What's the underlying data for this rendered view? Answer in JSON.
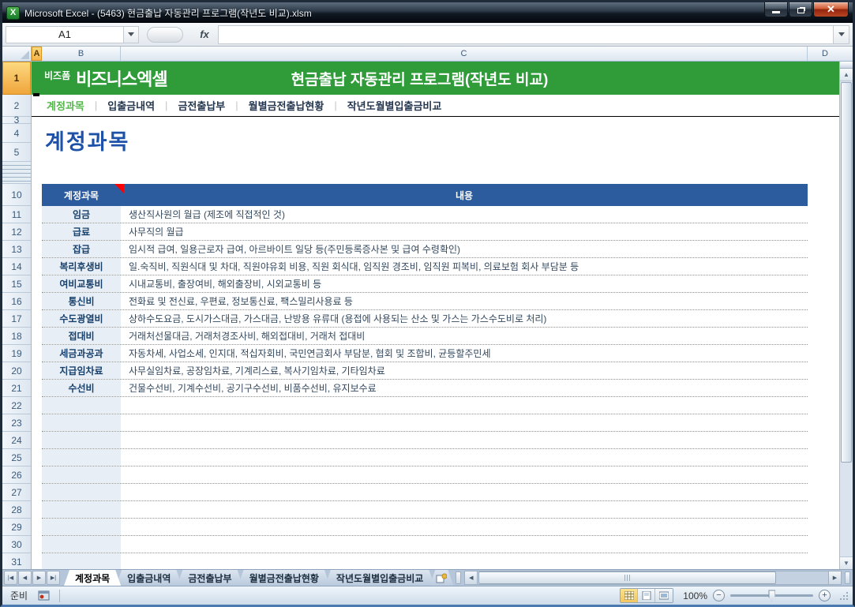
{
  "window": {
    "title": "Microsoft Excel - (5463) 현금출납 자동관리 프로그램(작년도 비교).xlsm",
    "controls": {
      "minimize": "minimize",
      "restore": "restore",
      "close": "close"
    }
  },
  "formula_bar": {
    "cell_ref": "A1",
    "fx_label": "fx",
    "value": ""
  },
  "grid": {
    "columns": [
      "A",
      "B",
      "C",
      "D"
    ],
    "selected_column": "A",
    "row_numbers": [
      "1",
      "2",
      "3",
      "4",
      "5",
      "10",
      "11",
      "12",
      "13",
      "14",
      "15",
      "16",
      "17",
      "18",
      "19",
      "20",
      "21",
      "22",
      "23",
      "24",
      "25",
      "26",
      "27",
      "28",
      "29",
      "30",
      "31"
    ],
    "selected_row": "1",
    "hidden_rows_note": "6-9"
  },
  "banner": {
    "logo_small": "비즈폼",
    "logo_large": "비즈니스엑셀",
    "title": "현금출납 자동관리 프로그램(작년도 비교)"
  },
  "nav": {
    "separator": "|",
    "items": [
      {
        "label": "계정과목",
        "active": true
      },
      {
        "label": "입출금내역",
        "active": false
      },
      {
        "label": "금전출납부",
        "active": false
      },
      {
        "label": "월별금전출납현황",
        "active": false
      },
      {
        "label": "작년도월별입출금비교",
        "active": false
      }
    ]
  },
  "page": {
    "title": "계정과목"
  },
  "table": {
    "headers": [
      "계정과목",
      "내용"
    ],
    "rows": [
      {
        "account": "임금",
        "description": "생산직사원의 월급 (제조에 직접적인 것)"
      },
      {
        "account": "급료",
        "description": "사무직의 월급"
      },
      {
        "account": "잡급",
        "description": "임시적 급여, 일용근로자 급여, 아르바이트 일당 등(주민등록증사본 및 급여 수령확인)"
      },
      {
        "account": "복리후생비",
        "description": "일.숙직비, 직원식대 및 차대, 직원야유회 비용, 직원  회식대, 임직원 경조비, 임직원 피복비, 의료보험 회사 부담분 등"
      },
      {
        "account": "여비교통비",
        "description": "시내교통비, 출장여비, 해외출장비, 시외교통비 등"
      },
      {
        "account": "통신비",
        "description": "전화료 및 전신료, 우편료, 정보통신료, 팩스밀리사용료  등"
      },
      {
        "account": "수도광열비",
        "description": "상하수도요금, 도시가스대금, 가스대금, 난방용 유류대 (용접에 사용되는 산소 및 가스는 가스수도비로 처리)"
      },
      {
        "account": "접대비",
        "description": "거래처선물대금, 거래처경조사비, 해외접대비, 거래처 접대비"
      },
      {
        "account": "세금과공과",
        "description": "자동차세, 사업소세, 인지대, 적십자회비, 국민연금회사 부담분, 협회 및 조합비, 균등할주민세"
      },
      {
        "account": "지급임차료",
        "description": "사무실임차료, 공장임차료, 기계리스료, 복사기임차료, 기타임차료"
      },
      {
        "account": "수선비",
        "description": "건물수선비, 기계수선비, 공기구수선비, 비품수선비, 유지보수료"
      }
    ],
    "empty_row_count": 10
  },
  "sheet_tabs": {
    "active": "계정과목",
    "tabs": [
      "계정과목",
      "입출금내역",
      "금전출납부",
      "월별금전출납현황",
      "작년도월별입출금비교"
    ]
  },
  "status_bar": {
    "ready_label": "준비",
    "zoom_level": "100%"
  },
  "colors": {
    "banner_green": "#2f9b39",
    "nav_active_green": "#55b64a",
    "page_title_blue": "#1d52a8",
    "table_header_blue": "#2d5c9e",
    "account_cell_bg": "#e8eef6",
    "selected_header_orange": "#f6b44a",
    "close_button_red": "#b84424"
  }
}
